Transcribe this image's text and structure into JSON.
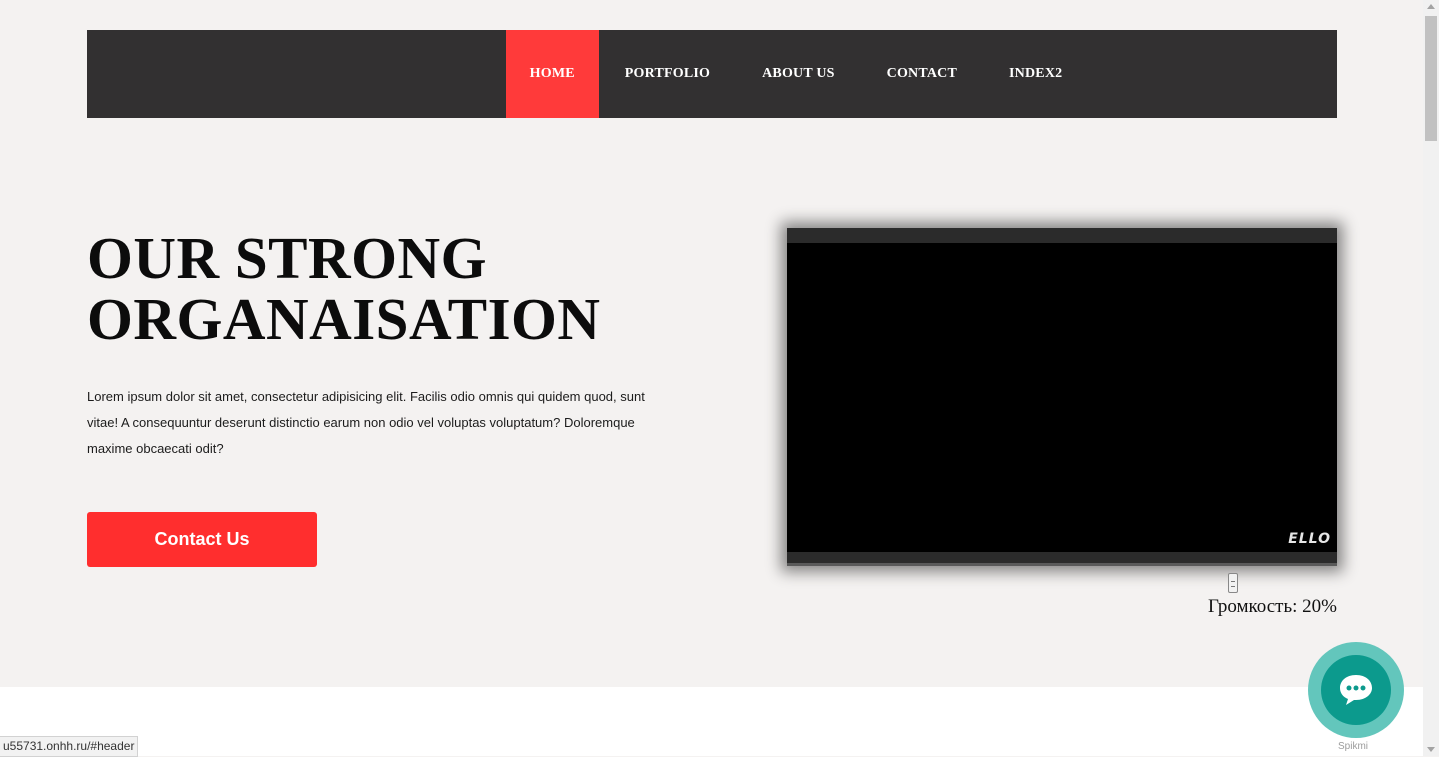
{
  "nav": {
    "items": [
      {
        "label": "HOME",
        "active": true
      },
      {
        "label": "PORTFOLIO",
        "active": false
      },
      {
        "label": "ABOUT US",
        "active": false
      },
      {
        "label": "CONTACT",
        "active": false
      },
      {
        "label": "INDEX2",
        "active": false
      }
    ]
  },
  "hero": {
    "title_line1": "OUR STRONG",
    "title_line2": "ORGANAISATION",
    "text": "Lorem ipsum dolor sit amet, consectetur adipisicing elit. Facilis odio omnis qui quidem quod, sunt vitae! A consequuntur deserunt distinctio earum non odio vel voluptas voluptatum? Doloremque maxime obcaecati odit?",
    "cta_label": "Contact Us"
  },
  "video": {
    "logo": "ELLO",
    "volume_label": "Громкость: 20%",
    "volume_level": 0.2
  },
  "chat": {
    "icon": "chat-bubble-icon",
    "brand": "Spikmi"
  },
  "status": {
    "url": "u55731.onhh.ru/#header"
  },
  "colors": {
    "accent": "#ff3a3a",
    "nav_bg": "#323031",
    "page_bg": "#f4f2f1",
    "chat": "#0c9a8d"
  }
}
